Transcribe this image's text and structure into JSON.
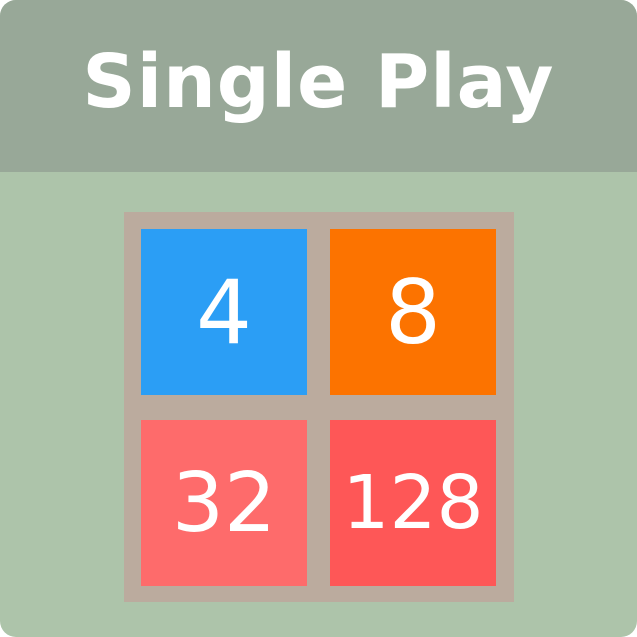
{
  "header": {
    "title": "Single Play"
  },
  "board": {
    "tiles": [
      {
        "value": "4",
        "color": "#2b9ef5"
      },
      {
        "value": "8",
        "color": "#fc7300"
      },
      {
        "value": "32",
        "color": "#fe6b6b"
      },
      {
        "value": "128",
        "color": "#fe5757"
      }
    ]
  },
  "colors": {
    "background": "#adc4aa",
    "header": "#98a898",
    "board": "#bbab9e"
  }
}
